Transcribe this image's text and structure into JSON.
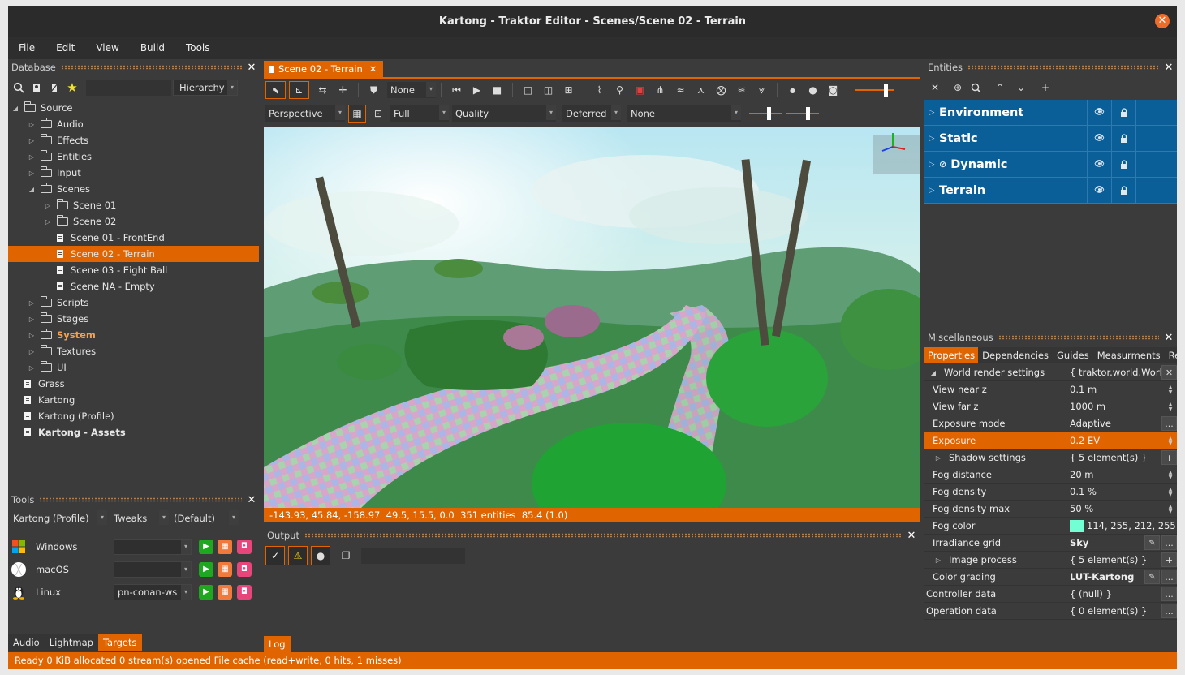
{
  "window": {
    "title": "Kartong - Traktor Editor - Scenes/Scene 02 - Terrain",
    "close_glyph": "✕"
  },
  "menu": [
    "File",
    "Edit",
    "View",
    "Build",
    "Tools"
  ],
  "database": {
    "title": "Database",
    "view_mode": "Hierarchy",
    "tree": [
      {
        "label": "Source",
        "depth": 0,
        "type": "folder",
        "expanded": true
      },
      {
        "label": "Audio",
        "depth": 1,
        "type": "folder"
      },
      {
        "label": "Effects",
        "depth": 1,
        "type": "folder"
      },
      {
        "label": "Entities",
        "depth": 1,
        "type": "folder"
      },
      {
        "label": "Input",
        "depth": 1,
        "type": "folder"
      },
      {
        "label": "Scenes",
        "depth": 1,
        "type": "folder",
        "expanded": true
      },
      {
        "label": "Scene 01",
        "depth": 2,
        "type": "folder"
      },
      {
        "label": "Scene 02",
        "depth": 2,
        "type": "folder"
      },
      {
        "label": "Scene 01 - FrontEnd",
        "depth": 2,
        "type": "doc"
      },
      {
        "label": "Scene 02 - Terrain",
        "depth": 2,
        "type": "doc",
        "selected": true
      },
      {
        "label": "Scene 03 - Eight Ball",
        "depth": 2,
        "type": "doc"
      },
      {
        "label": "Scene NA - Empty",
        "depth": 2,
        "type": "doc"
      },
      {
        "label": "Scripts",
        "depth": 1,
        "type": "folder"
      },
      {
        "label": "Stages",
        "depth": 1,
        "type": "folder"
      },
      {
        "label": "System",
        "depth": 1,
        "type": "folder",
        "accent": true
      },
      {
        "label": "Textures",
        "depth": 1,
        "type": "folder"
      },
      {
        "label": "UI",
        "depth": 1,
        "type": "folder"
      },
      {
        "label": "Grass",
        "depth": 0,
        "type": "doc"
      },
      {
        "label": "Kartong",
        "depth": 0,
        "type": "doc"
      },
      {
        "label": "Kartong (Profile)",
        "depth": 0,
        "type": "doc"
      },
      {
        "label": "Kartong - Assets",
        "depth": 0,
        "type": "doc",
        "bold": true
      }
    ]
  },
  "tools": {
    "title": "Tools",
    "config": "Kartong (Profile)",
    "tweaks": "Tweaks",
    "default": "(Default)",
    "targets": [
      {
        "name": "Windows",
        "host": ""
      },
      {
        "name": "macOS",
        "host": ""
      },
      {
        "name": "Linux",
        "host": "pn-conan-ws"
      }
    ],
    "bottom_tabs": [
      "Audio",
      "Lightmap",
      "Targets"
    ],
    "active_bottom_tab": "Targets"
  },
  "editor": {
    "tab": "Scene 02 - Terrain",
    "tab_close": "✕",
    "snap_mode": "None",
    "view_mode": "Perspective",
    "resolution": "Full",
    "quality": "Quality",
    "renderer": "Deferred",
    "post": "None",
    "status": "-143.93, 45.84, -158.97  49.5, 15.5, 0.0  351 entities  85.4 (1.0)"
  },
  "output": {
    "title": "Output",
    "tab": "Log"
  },
  "entities": {
    "title": "Entities",
    "layers": [
      "Environment",
      "Static",
      "Dynamic",
      "Terrain"
    ]
  },
  "misc": {
    "title": "Miscellaneous",
    "tabs": [
      "Properties",
      "Dependencies",
      "Guides",
      "Measurments",
      "Re"
    ],
    "active_tab": "Properties",
    "properties": [
      {
        "name": "World render settings",
        "value": "{ traktor.world.Worl",
        "indent": 0,
        "toggle": "▲",
        "btn": "✕"
      },
      {
        "name": "View near z",
        "value": "0.1 m",
        "indent": 1,
        "spin": true
      },
      {
        "name": "View far z",
        "value": "1000 m",
        "indent": 1,
        "spin": true
      },
      {
        "name": "Exposure mode",
        "value": "Adaptive",
        "indent": 1,
        "btn": "..."
      },
      {
        "name": "Exposure",
        "value": "0.2 EV",
        "indent": 1,
        "spin": true,
        "highlight": true
      },
      {
        "name": "Shadow settings",
        "value": "{ 5 element(s) }",
        "indent": 1,
        "toggle": "▷",
        "btn": "+"
      },
      {
        "name": "Fog distance",
        "value": "20 m",
        "indent": 1,
        "spin": true
      },
      {
        "name": "Fog density",
        "value": "0.1 %",
        "indent": 1,
        "spin": true
      },
      {
        "name": "Fog density max",
        "value": "50 %",
        "indent": 1,
        "spin": true
      },
      {
        "name": "Fog color",
        "value": "114, 255, 212, 255",
        "indent": 1,
        "swatch": "#72ffd4"
      },
      {
        "name": "Irradiance grid",
        "value": "Sky",
        "indent": 1,
        "bold": true,
        "btn": "...",
        "btn2": "✎"
      },
      {
        "name": "Image process",
        "value": "{ 5 element(s) }",
        "indent": 1,
        "toggle": "▷",
        "btn": "+"
      },
      {
        "name": "Color grading",
        "value": "LUT-Kartong",
        "indent": 1,
        "bold": true,
        "btn": "...",
        "btn2": "✎"
      },
      {
        "name": "Controller data",
        "value": "{ (null) }",
        "indent": 0,
        "btn": "..."
      },
      {
        "name": "Operation data",
        "value": "{ 0 element(s) }",
        "indent": 0,
        "btn": "..."
      }
    ]
  },
  "statusbar": "Ready  0 KiB allocated  0 stream(s) opened  File cache (read+write, 0 hits, 1 misses)",
  "colors": {
    "accent": "#e06500",
    "entity_row": "#0a5f99",
    "panel": "#3b3b3b"
  }
}
